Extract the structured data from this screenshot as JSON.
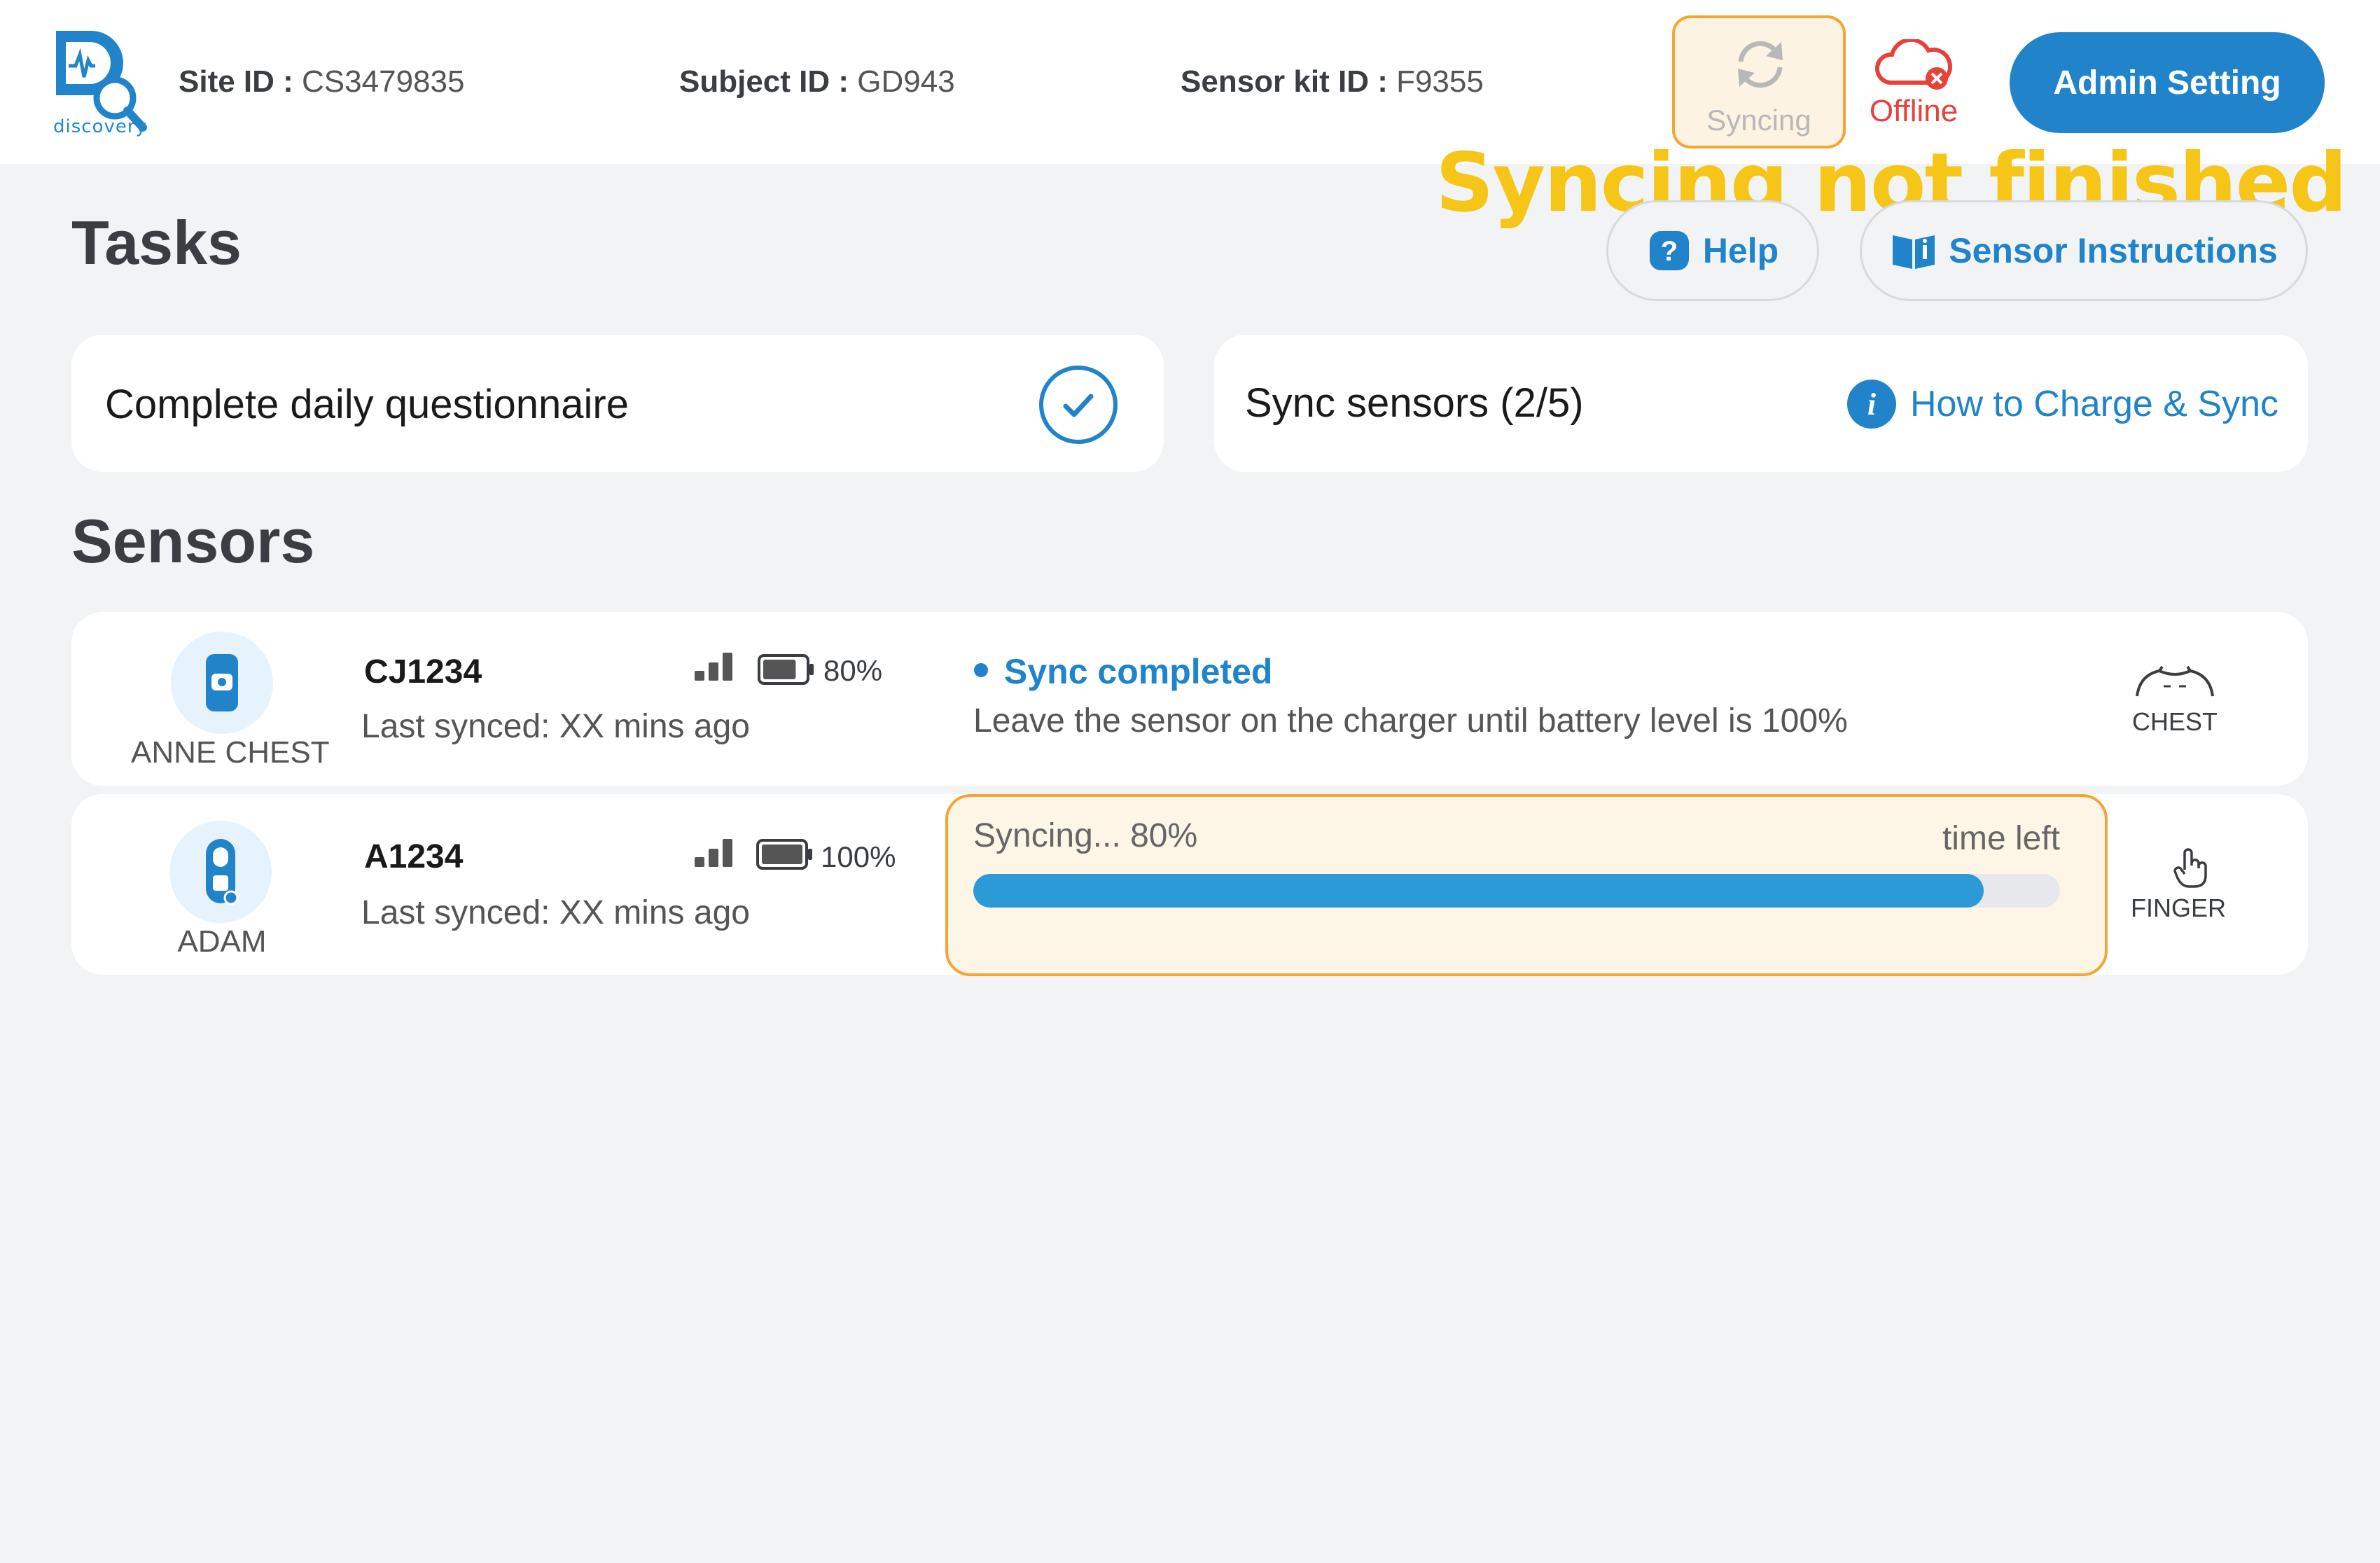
{
  "header": {
    "logo_word": "discovery",
    "site_id_label": "Site ID :",
    "site_id_value": "CS3479835",
    "subject_id_label": "Subject ID :",
    "subject_id_value": "GD943",
    "sensor_kit_label": "Sensor kit ID :",
    "sensor_kit_value": "F9355",
    "syncing_label": "Syncing",
    "offline_label": "Offline",
    "admin_button": "Admin Setting"
  },
  "annotation": "Syncing not finished",
  "tasks": {
    "title": "Tasks",
    "help_button": "Help",
    "instructions_button": "Sensor Instructions",
    "questionnaire": "Complete daily questionnaire",
    "sync_sensors": "Sync sensors (2/5)",
    "how_to_link": "How to Charge & Sync"
  },
  "sensors": {
    "title": "Sensors",
    "rows": [
      {
        "name": "ANNE CHEST",
        "id": "CJ1234",
        "last_synced": "Last synced: XX mins ago",
        "battery": "80%",
        "battery_level": 0.8,
        "status_title": "Sync completed",
        "status_desc": "Leave the sensor on the charger until battery level is 100%",
        "location": "CHEST"
      },
      {
        "name": "ADAM",
        "id": "A1234",
        "last_synced": "Last synced: XX mins ago",
        "battery": "100%",
        "battery_level": 1.0,
        "progress_text": "Syncing...  80%",
        "time_left": "time left",
        "progress": 0.93,
        "location": "FINGER"
      }
    ]
  },
  "colors": {
    "accent": "#2184cb",
    "warning": "#f5a533",
    "error": "#e8413b",
    "annotation": "#f5c518"
  }
}
